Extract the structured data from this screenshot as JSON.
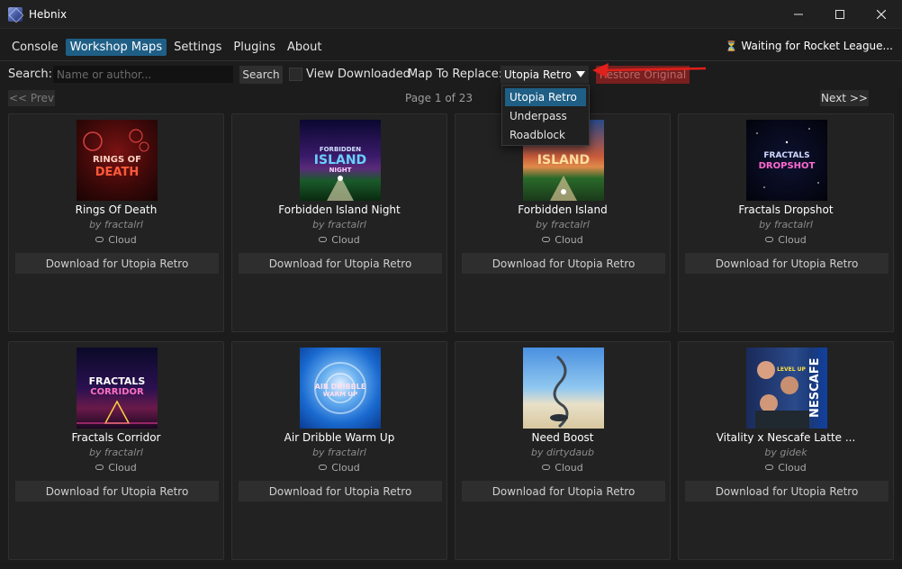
{
  "window": {
    "title": "Hebnix",
    "controls": [
      "minimize",
      "maximize",
      "close"
    ]
  },
  "menu": {
    "items": [
      {
        "label": "Console"
      },
      {
        "label": "Workshop Maps",
        "active": true
      },
      {
        "label": "Settings"
      },
      {
        "label": "Plugins"
      },
      {
        "label": "About"
      }
    ],
    "status": "Waiting for Rocket League..."
  },
  "toolbar": {
    "search_label": "Search:",
    "search_placeholder": "Name or author...",
    "search_value": "",
    "search_button": "Search",
    "view_downloaded_label": "View Downloaded",
    "view_downloaded_checked": false,
    "map_to_replace_label": "Map To Replace:",
    "map_selected": "Utopia Retro",
    "restore_button": "Restore Original"
  },
  "dropdown": {
    "options": [
      "Utopia Retro",
      "Underpass",
      "Roadblock"
    ],
    "selected_index": 0
  },
  "pager": {
    "prev": "<< Prev",
    "page_text": "Page 1 of 23",
    "next": "Next >>"
  },
  "colors": {
    "accent": "#1f5f86",
    "restore_bg": "#7a1f1f",
    "annotation_arrow": "#e0201a"
  },
  "maps": [
    {
      "title": "Rings Of Death",
      "author": "by fractalrl",
      "source": "Cloud",
      "download": "Download for Utopia Retro",
      "thumb_text": [
        "RINGS OF",
        "DEATH"
      ]
    },
    {
      "title": "Forbidden Island Night",
      "author": "by fractalrl",
      "source": "Cloud",
      "download": "Download for Utopia Retro",
      "thumb_text": [
        "FORBIDDEN",
        "ISLAND",
        "NIGHT"
      ]
    },
    {
      "title": "Forbidden Island",
      "author": "by fractalrl",
      "source": "Cloud",
      "download": "Download for Utopia Retro",
      "thumb_text": [
        "ISLAND"
      ]
    },
    {
      "title": "Fractals Dropshot",
      "author": "by fractalrl",
      "source": "Cloud",
      "download": "Download for Utopia Retro",
      "thumb_text": [
        "FRACTALS",
        "DROPSHOT"
      ]
    },
    {
      "title": "Fractals Corridor",
      "author": "by fractalrl",
      "source": "Cloud",
      "download": "Download for Utopia Retro",
      "thumb_text": [
        "FRACTALS",
        "CORRIDOR"
      ]
    },
    {
      "title": "Air Dribble Warm Up",
      "author": "by fractalrl",
      "source": "Cloud",
      "download": "Download for Utopia Retro",
      "thumb_text": [
        "AIR DRIBBLE",
        "WARM UP"
      ]
    },
    {
      "title": "Need Boost",
      "author": "by dirtydaub",
      "source": "Cloud",
      "download": "Download for Utopia Retro",
      "thumb_text": []
    },
    {
      "title": "Vitality x Nescafe Latte ...",
      "author": "by gidek",
      "source": "Cloud",
      "download": "Download for Utopia Retro",
      "thumb_text": [
        "NESCAFE",
        "LEVEL UP"
      ]
    }
  ]
}
